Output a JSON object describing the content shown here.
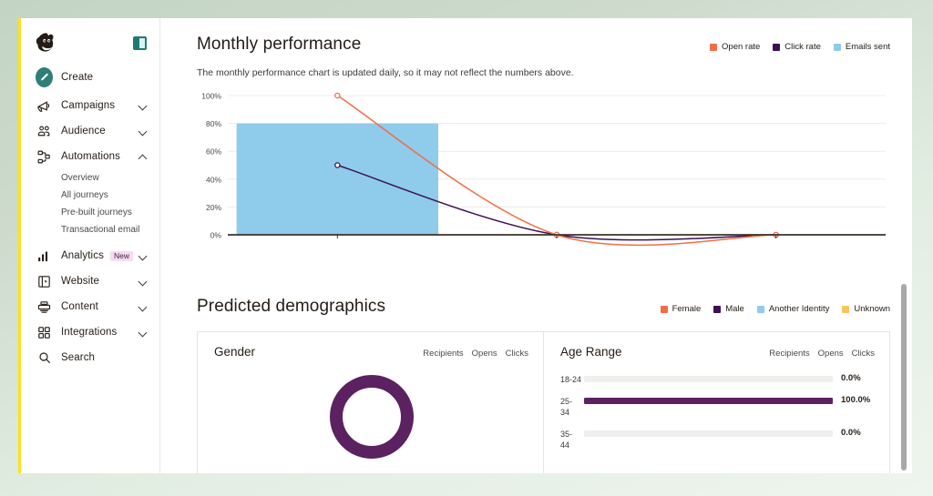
{
  "app": {
    "logo_icon": "mailchimp-freddie-logo",
    "panel_toggle_icon": "collapse-panel-icon",
    "accent_yellow": "#ffe01b",
    "accent_teal": "#2d7f77"
  },
  "sidebar": {
    "items": [
      {
        "label": "Create",
        "icon": "pencil-icon",
        "type": "create",
        "expandable": false
      },
      {
        "label": "Campaigns",
        "icon": "megaphone-icon",
        "type": "nav",
        "expandable": true,
        "expanded": false
      },
      {
        "label": "Audience",
        "icon": "people-icon",
        "type": "nav",
        "expandable": true,
        "expanded": false
      },
      {
        "label": "Automations",
        "icon": "automations-icon",
        "type": "nav",
        "expandable": true,
        "expanded": true
      },
      {
        "label": "Analytics",
        "icon": "bar-chart-icon",
        "type": "nav",
        "expandable": true,
        "expanded": false,
        "badge": "New"
      },
      {
        "label": "Website",
        "icon": "website-icon",
        "type": "nav",
        "expandable": true,
        "expanded": false
      },
      {
        "label": "Content",
        "icon": "content-icon",
        "type": "nav",
        "expandable": true,
        "expanded": false
      },
      {
        "label": "Integrations",
        "icon": "grid-icon",
        "type": "nav",
        "expandable": true,
        "expanded": false
      },
      {
        "label": "Search",
        "icon": "search-icon",
        "type": "nav",
        "expandable": false
      }
    ],
    "automations_subitems": [
      {
        "label": "Overview"
      },
      {
        "label": "All journeys"
      },
      {
        "label": "Pre-built journeys"
      },
      {
        "label": "Transactional email"
      }
    ]
  },
  "performance": {
    "title": "Monthly performance",
    "subtitle": "The monthly performance chart is updated daily, so it may not reflect the numbers above.",
    "legend": [
      {
        "label": "Open rate",
        "color": "#f26d45"
      },
      {
        "label": "Click rate",
        "color": "#3c1053"
      },
      {
        "label": "Emails sent",
        "color": "#8fcbeb"
      }
    ]
  },
  "demographics": {
    "title": "Predicted demographics",
    "legend": [
      {
        "label": "Female",
        "color": "#f26d45"
      },
      {
        "label": "Male",
        "color": "#3c1053"
      },
      {
        "label": "Another Identity",
        "color": "#8fcbeb"
      },
      {
        "label": "Unknown",
        "color": "#f7c65a"
      }
    ],
    "gender_card": {
      "title": "Gender",
      "columns": [
        "Recipients",
        "Opens",
        "Clicks"
      ]
    },
    "age_card": {
      "title": "Age Range",
      "columns": [
        "Recipients",
        "Opens",
        "Clicks"
      ]
    }
  },
  "chart_data": [
    {
      "type": "line",
      "title": "Monthly performance",
      "subtitle": "The monthly performance chart is updated daily, so it may not reflect the numbers above.",
      "xlabel": "",
      "ylabel": "",
      "ylim": [
        0,
        100
      ],
      "ytick_labels": [
        "0%",
        "20%",
        "40%",
        "60%",
        "80%",
        "100%"
      ],
      "ytick_values": [
        0,
        20,
        40,
        60,
        80,
        100
      ],
      "grid": true,
      "legend_position": "top-right",
      "x": [
        1,
        2,
        3
      ],
      "series": [
        {
          "name": "Emails sent",
          "type": "bar",
          "color": "#8fcbeb",
          "values": [
            80,
            0,
            0
          ]
        },
        {
          "name": "Open rate",
          "type": "line",
          "color": "#f26d45",
          "values": [
            100,
            0,
            0
          ]
        },
        {
          "name": "Click rate",
          "type": "line",
          "color": "#3c1053",
          "values": [
            50,
            0,
            0
          ]
        }
      ]
    },
    {
      "type": "pie",
      "title": "Gender",
      "labels": [
        "Male",
        "Female",
        "Another Identity",
        "Unknown"
      ],
      "values": [
        100,
        0,
        0,
        0
      ],
      "colors": [
        "#5c2160",
        "#f26d45",
        "#8fcbeb",
        "#f7c65a"
      ],
      "donut": true,
      "legend_position": "top-right"
    },
    {
      "type": "bar",
      "title": "Age Range",
      "orientation": "horizontal",
      "categories": [
        "18-24",
        "25-34",
        "35-44"
      ],
      "values": [
        0.0,
        100.0,
        0.0
      ],
      "value_labels": [
        "0.0%",
        "100.0%",
        "0.0%"
      ],
      "bar_color": "#5c2160",
      "track_color": "#efefed",
      "xlim": [
        0,
        100
      ]
    }
  ],
  "age_rows": [
    {
      "label_lines": [
        "18-24"
      ],
      "pct_text": "0.0%",
      "pct": 0
    },
    {
      "label_lines": [
        "25-",
        "34"
      ],
      "pct_text": "100.0%",
      "pct": 100
    },
    {
      "label_lines": [
        "35-",
        "44"
      ],
      "pct_text": "0.0%",
      "pct": 0
    }
  ]
}
